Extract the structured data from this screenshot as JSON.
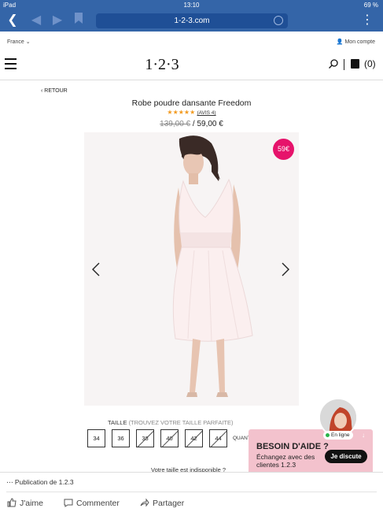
{
  "status_bar": {
    "device": "iPad",
    "time": "13:10",
    "battery": "69 %"
  },
  "browser": {
    "url": "1-2-3.com"
  },
  "site": {
    "country": "France",
    "account_label": "Mon compte",
    "logo_text": "1·2·3",
    "cart_count": "(0)"
  },
  "product": {
    "back_label": "‹ RETOUR",
    "title": "Robe poudre dansante Freedom",
    "stars": "★★★★★",
    "reviews_label": "(AVIS 4)",
    "old_price": "139,00 €",
    "price_sep": " / ",
    "new_price": "59,00 €",
    "badge": "59€",
    "size_label": "TAILLE",
    "size_hint": "(TROUVEZ VOTRE TAILLE PARFAITE)",
    "sizes": [
      {
        "label": "34",
        "available": true
      },
      {
        "label": "36",
        "available": true
      },
      {
        "label": "38",
        "available": false
      },
      {
        "label": "40",
        "available": false
      },
      {
        "label": "42",
        "available": false
      },
      {
        "label": "44",
        "available": false
      }
    ],
    "quantity_label": "QUANTITÉ",
    "unavailable_text": "Votre taille est indisponible ?"
  },
  "chat": {
    "title": "BESOIN D'AIDE ?",
    "text": "Échangez avec des clientes 1.2.3",
    "button": "Je discute",
    "status": "En ligne"
  },
  "facebook": {
    "publication": "Publication de 1.2.3",
    "like": "J'aime",
    "comment": "Commenter",
    "share": "Partager"
  },
  "colors": {
    "brand_blue": "#3465a8",
    "badge_pink": "#e6136b",
    "chat_pink": "#f3c2cd",
    "star": "#f29a1f"
  }
}
